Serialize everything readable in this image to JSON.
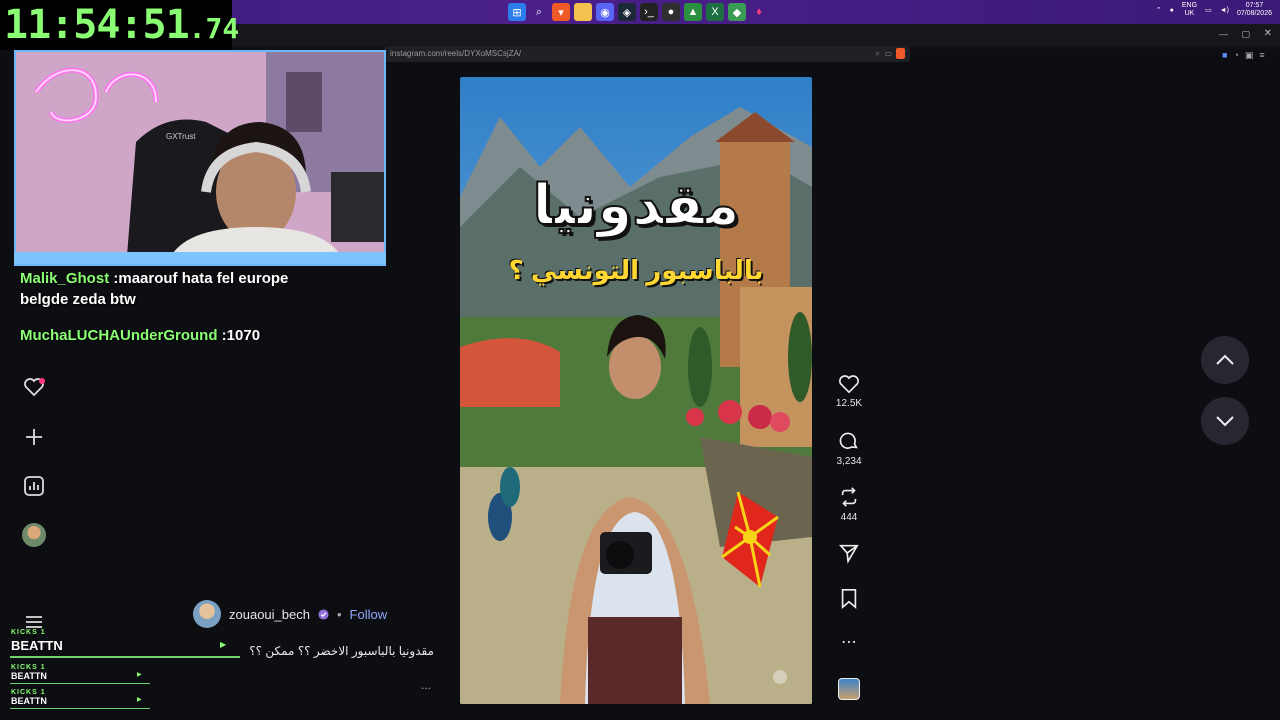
{
  "clock": {
    "main": "11:54:51",
    "fraction": ".74"
  },
  "system": {
    "language_line1": "ENG",
    "language_line2": "UK",
    "time": "07:57",
    "date": "07/08/2026"
  },
  "browser": {
    "url": "instagram.com/reels/DYXoMSCsjZA/"
  },
  "webcam": {
    "chair_brand": "GXTrust"
  },
  "chat": [
    {
      "user": "Malik_Ghost",
      "message": " :maarouf hata fel europe",
      "message_line2": "belgde zeda btw"
    },
    {
      "user": "MuchaLUCHAUnderGround",
      "message": " :1070"
    }
  ],
  "kicks": [
    {
      "label": "KICKS 1",
      "name": "BEATTN"
    },
    {
      "label": "KICKS 1",
      "name": "BEATTN"
    },
    {
      "label": "KICKS 1",
      "name": "BEATTN"
    }
  ],
  "reel": {
    "title_main": "مقدونيا",
    "title_sub": "بالباسبور التونسي ؟",
    "author": "zouaoui_bech",
    "follow_label": "Follow",
    "separator": "•",
    "caption": "مقدونيا بالباسبور الاخضر ؟؟ ممكن ؟؟",
    "more": "...",
    "likes": "12.5K",
    "comments": "3,234",
    "reposts": "444"
  },
  "colors": {
    "accent_green": "#8bff74",
    "follow_blue": "#8fa8ff",
    "taskbar": "#4a1f8a"
  }
}
